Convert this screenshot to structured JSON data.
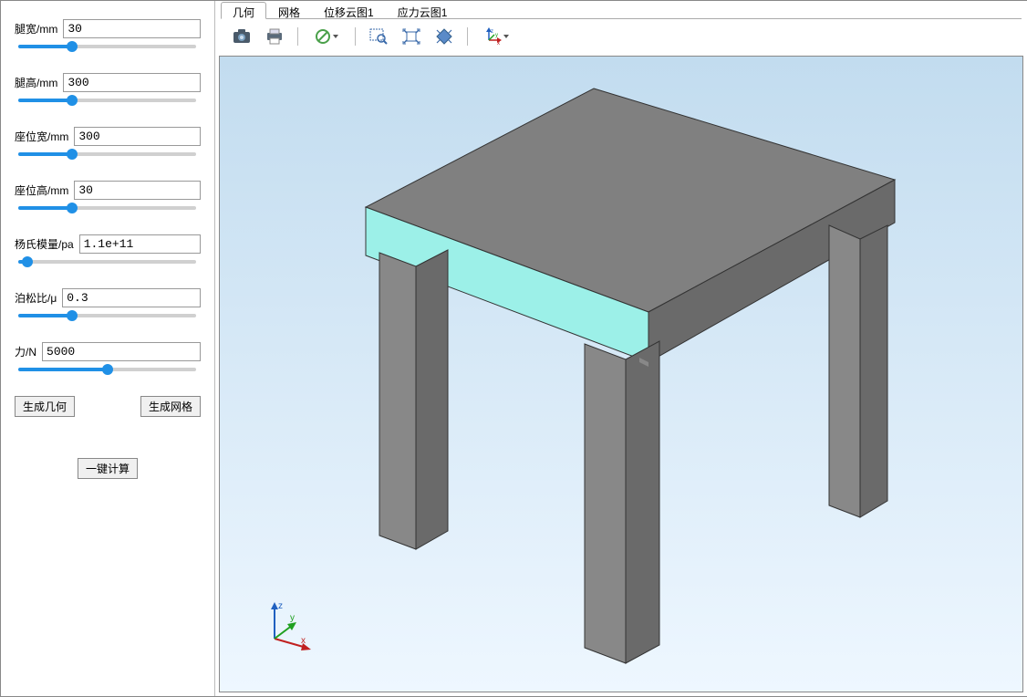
{
  "sidebar": {
    "params": [
      {
        "label": "腿宽/mm",
        "value": "30",
        "slider_pct": 30
      },
      {
        "label": "腿高/mm",
        "value": "300",
        "slider_pct": 30
      },
      {
        "label": "座位宽/mm",
        "value": "300",
        "slider_pct": 30
      },
      {
        "label": "座位高/mm",
        "value": "30",
        "slider_pct": 30
      },
      {
        "label": "杨氏模量/pa",
        "value": "1.1e+11",
        "slider_pct": 5
      },
      {
        "label": "泊松比/μ",
        "value": "0.3",
        "slider_pct": 30
      },
      {
        "label": "力/N",
        "value": "5000",
        "slider_pct": 50
      }
    ],
    "buttons": {
      "gen_geom": "生成几何",
      "gen_mesh": "生成网格",
      "compute": "一键计算"
    }
  },
  "tabs": [
    {
      "label": "几何",
      "active": true
    },
    {
      "label": "网格",
      "active": false
    },
    {
      "label": "位移云图1",
      "active": false
    },
    {
      "label": "应力云图1",
      "active": false
    }
  ],
  "toolbar": {
    "items": [
      {
        "name": "screenshot-icon",
        "kind": "camera"
      },
      {
        "name": "print-icon",
        "kind": "printer"
      },
      {
        "sep": true
      },
      {
        "name": "disable-icon",
        "kind": "forbidden",
        "dropdown": true
      },
      {
        "sep": true
      },
      {
        "name": "zoom-window-icon",
        "kind": "zoom-box"
      },
      {
        "name": "zoom-extent-icon",
        "kind": "extent"
      },
      {
        "name": "zoom-select-icon",
        "kind": "fit-select"
      },
      {
        "sep": true
      },
      {
        "name": "axes-icon",
        "kind": "axes",
        "dropdown": true
      }
    ]
  },
  "axes_labels": {
    "x": "x",
    "y": "y",
    "z": "z"
  }
}
